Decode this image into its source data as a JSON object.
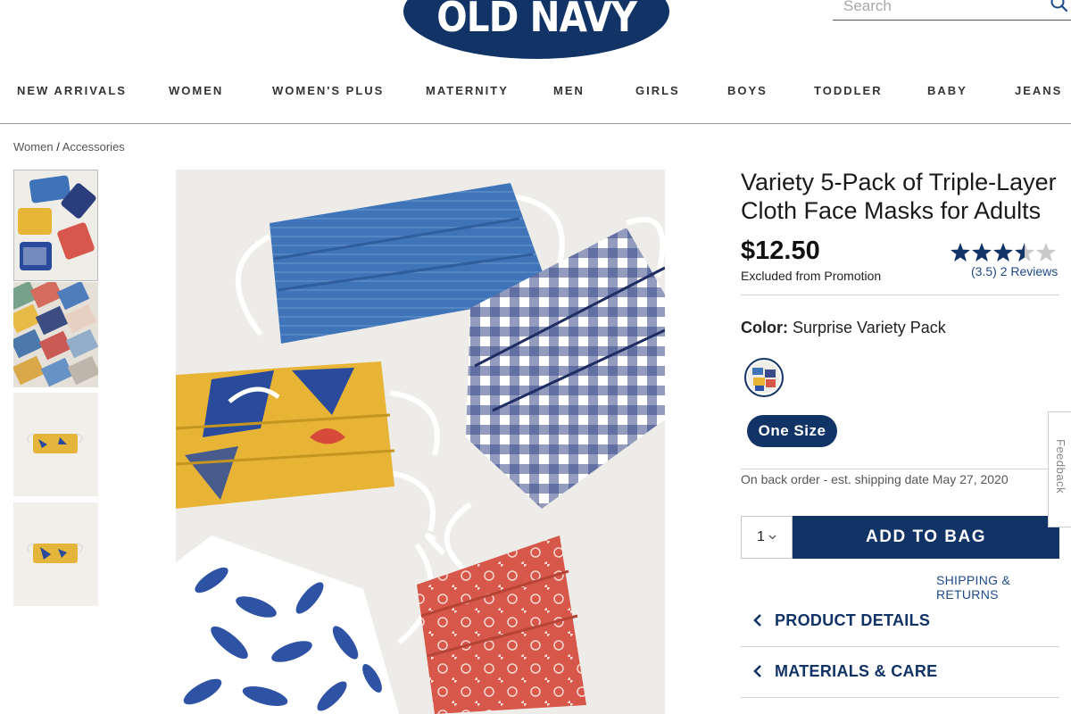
{
  "brand": {
    "logo_text": "OLD NAVY",
    "color": "#113366"
  },
  "search": {
    "placeholder": "Search",
    "icon": "magnifier-icon"
  },
  "nav": {
    "items": [
      "NEW ARRIVALS",
      "WOMEN",
      "WOMEN'S PLUS",
      "MATERNITY",
      "MEN",
      "GIRLS",
      "BOYS",
      "TODDLER",
      "BABY",
      "JEANS"
    ]
  },
  "breadcrumb": {
    "parent": "Women",
    "separator": "/",
    "current": "Accessories"
  },
  "thumbnails": {
    "count": 4,
    "selected_index": 0
  },
  "product": {
    "title": "Variety 5-Pack of Triple-Layer Cloth Face Masks for Adults",
    "price": "$12.50",
    "promo_note": "Excluded from Promotion",
    "rating": 3.5,
    "rating_text": "(3.5)",
    "reviews_text": "2 Reviews",
    "color_label": "Color:",
    "color_value": "Surprise Variety Pack",
    "size_label": "One Size",
    "availability": "On back order - est. shipping date May 27, 2020",
    "quantity": "1",
    "add_to_bag": "ADD TO BAG",
    "shipping_link": "SHIPPING & RETURNS"
  },
  "accordions": [
    {
      "label": "PRODUCT DETAILS"
    },
    {
      "label": "MATERIALS & CARE"
    }
  ],
  "feedback_tab": "Feedback",
  "colors": {
    "accent": "#113366",
    "link": "#1e4a8a"
  }
}
